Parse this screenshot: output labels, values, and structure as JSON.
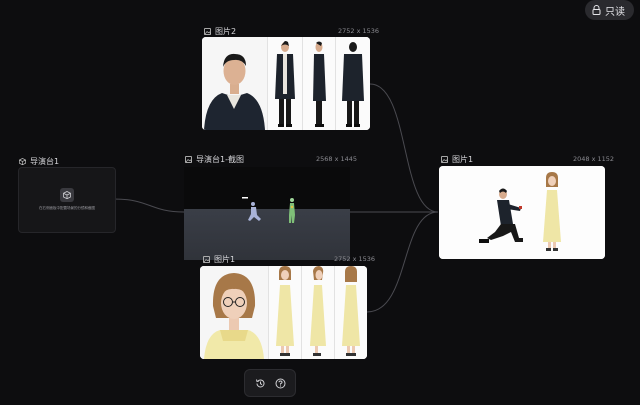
{
  "toolbar_top": {
    "readonly_label": "只读"
  },
  "nodes": {
    "image2": {
      "title": "图片2",
      "dims": "2752 x 1536"
    },
    "director": {
      "title": "导演台1",
      "hint": "在右侧面板中配置场景的分镜和截图"
    },
    "screenshot": {
      "title": "导演台1-截图",
      "dims": "2568 x 1445"
    },
    "image1": {
      "title": "图片1",
      "dims": "2048 x 1152"
    },
    "image_bottom": {
      "title": "图片1",
      "dims": "2752 x 1536"
    }
  },
  "bottom_toolbar": {
    "buttons": [
      "history-icon",
      "help-icon"
    ]
  },
  "colors": {
    "background": "#0d0d0f",
    "edge": "#4a4a50",
    "node": "#161618"
  }
}
